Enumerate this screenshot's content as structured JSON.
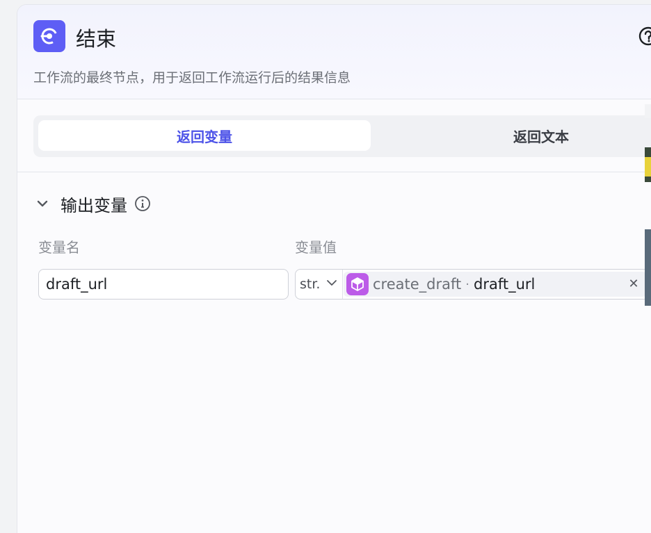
{
  "node": {
    "title": "结束",
    "description": "工作流的最终节点，用于返回工作流运行后的结果信息",
    "icon": "end-node-icon",
    "help_icon": "question-icon"
  },
  "tabs": {
    "active_label": "返回变量",
    "inactive_label": "返回文本"
  },
  "output_section": {
    "title": "输出变量",
    "info_icon": "info-icon",
    "col_name_label": "变量名",
    "col_value_label": "变量值",
    "rows": [
      {
        "name": "draft_url",
        "type": "str.",
        "ref_node": "create_draft",
        "ref_var": "draft_url",
        "ref_icon": "cube-icon"
      }
    ]
  },
  "colors": {
    "accent": "#4d53e8",
    "node_icon_bg": "#5e5ef5",
    "ref_icon_bg": "#bc5ce8"
  }
}
